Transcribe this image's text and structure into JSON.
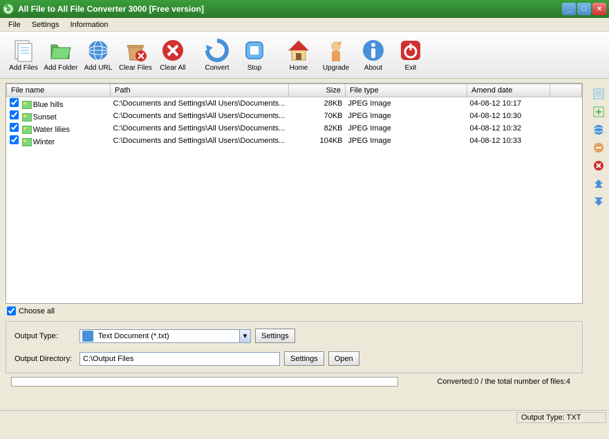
{
  "title": "All File to All File Converter 3000 [Free version]",
  "menu": [
    "File",
    "Settings",
    "Information"
  ],
  "toolbar": [
    {
      "label": "Add Files",
      "icon": "files"
    },
    {
      "label": "Add Folder",
      "icon": "folder"
    },
    {
      "label": "Add URL",
      "icon": "globe"
    },
    {
      "label": "Clear Files",
      "icon": "clear-files"
    },
    {
      "label": "Clear All",
      "icon": "clear-all"
    },
    {
      "sep": true
    },
    {
      "label": "Convert",
      "icon": "convert"
    },
    {
      "label": "Stop",
      "icon": "stop"
    },
    {
      "sep": true
    },
    {
      "label": "Home",
      "icon": "home"
    },
    {
      "label": "Upgrade",
      "icon": "upgrade"
    },
    {
      "label": "About",
      "icon": "about"
    },
    {
      "label": "Exit",
      "icon": "exit"
    }
  ],
  "columns": {
    "name": "File name",
    "path": "Path",
    "size": "Size",
    "type": "File type",
    "date": "Amend date"
  },
  "rows": [
    {
      "checked": true,
      "name": "Blue hills",
      "path": "C:\\Documents and Settings\\All Users\\Documents...",
      "size": "28KB",
      "type": "JPEG Image",
      "date": "04-08-12 10:17"
    },
    {
      "checked": true,
      "name": "Sunset",
      "path": "C:\\Documents and Settings\\All Users\\Documents...",
      "size": "70KB",
      "type": "JPEG Image",
      "date": "04-08-12 10:30"
    },
    {
      "checked": true,
      "name": "Water lilies",
      "path": "C:\\Documents and Settings\\All Users\\Documents...",
      "size": "82KB",
      "type": "JPEG Image",
      "date": "04-08-12 10:32"
    },
    {
      "checked": true,
      "name": "Winter",
      "path": "C:\\Documents and Settings\\All Users\\Documents...",
      "size": "104KB",
      "type": "JPEG Image",
      "date": "04-08-12 10:33"
    }
  ],
  "choose_all": "Choose all",
  "output_type_label": "Output Type:",
  "output_type_value": "Text Document (*.txt)",
  "output_dir_label": "Output Directory:",
  "output_dir_value": "C:\\Output Files",
  "settings_btn": "Settings",
  "open_btn": "Open",
  "progress_text": "Converted:0  /  the total number of files:4",
  "status_text": "Output Type: TXT",
  "side_icons": [
    "list",
    "add",
    "globe",
    "remove",
    "delete",
    "up",
    "down"
  ]
}
